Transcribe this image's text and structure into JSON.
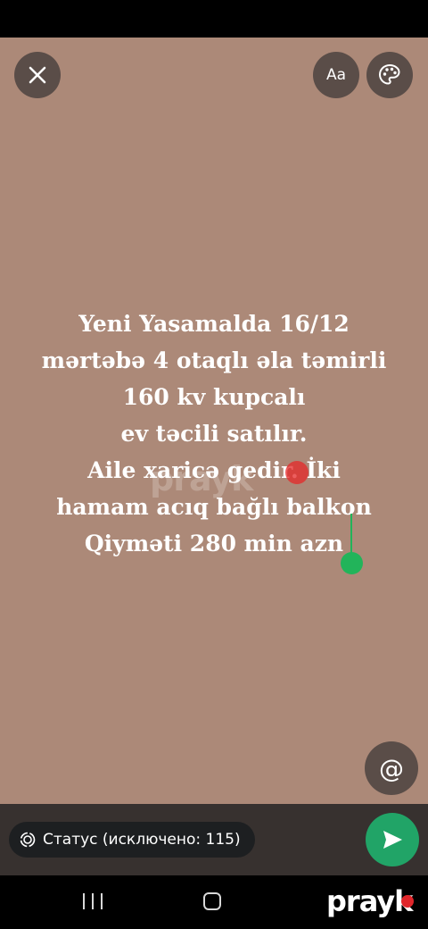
{
  "toolbar": {
    "close_icon": "close-icon",
    "font_label": "Aa",
    "palette_icon": "palette-icon"
  },
  "status_text": {
    "lines": [
      "Yeni Yasamalda 16/12",
      "mərtəbə 4 otaqlı əla təmirli",
      "160 kv kupcalı",
      "ev təcili satılır.",
      "Aile xaricə gedir. İki",
      "hamam acıq bağlı balkon",
      "Qiyməti 280 min azn"
    ]
  },
  "watermark": {
    "text": "prayk"
  },
  "mention": {
    "label": "@"
  },
  "bottom_bar": {
    "status_label": "Статус (исключено: 115)",
    "send_icon": "send-icon"
  },
  "nav": {
    "brand": "prayk"
  },
  "colors": {
    "canvas": "#ac8978",
    "accent": "#21a467",
    "bar": "#37312f"
  }
}
